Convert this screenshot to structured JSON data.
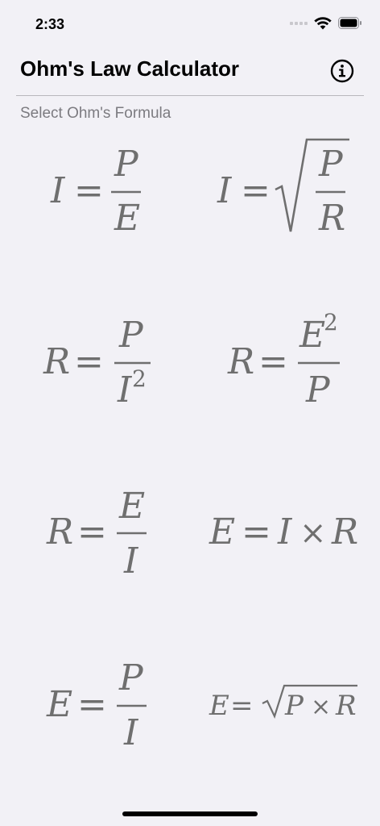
{
  "status_bar": {
    "time": "2:33"
  },
  "header": {
    "title": "Ohm's Law Calculator",
    "info_icon": "info-circle-icon"
  },
  "section_label": "Select Ohm's Formula",
  "formulas": [
    {
      "lhs": "I",
      "num": "P",
      "den": "E"
    },
    {
      "lhs": "I",
      "num": "P",
      "den": "R"
    },
    {
      "lhs": "R",
      "num": "P",
      "den": "I",
      "den_exp": "2"
    },
    {
      "lhs": "R",
      "num": "E",
      "num_exp": "2",
      "den": "P"
    },
    {
      "lhs": "R",
      "num": "E",
      "den": "I"
    },
    {
      "lhs": "E",
      "a": "I",
      "b": "R"
    },
    {
      "lhs": "E",
      "num": "P",
      "den": "I"
    },
    {
      "lhs": "E",
      "a": "P",
      "b": "R"
    }
  ],
  "symbols": {
    "equals": "=",
    "times": "×"
  },
  "colors": {
    "background": "#f2f1f6",
    "formula_gray": "#6f6f6f",
    "label_gray": "#7c7b80"
  }
}
